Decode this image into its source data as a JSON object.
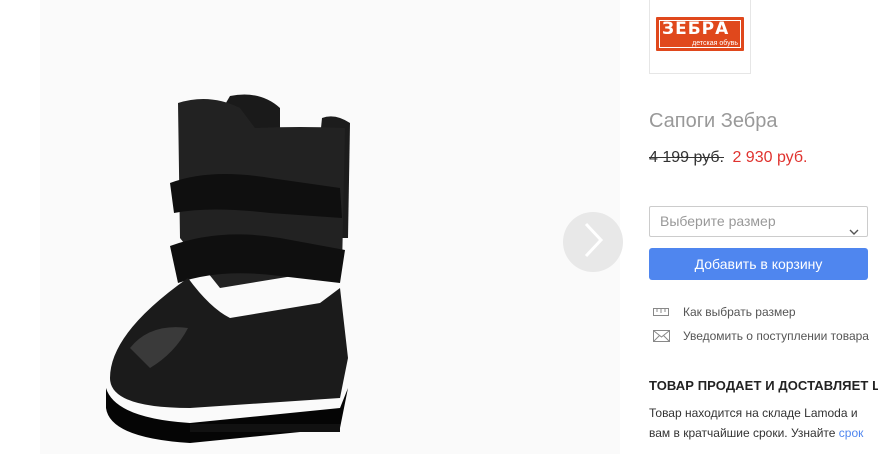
{
  "product": {
    "brand_logo": {
      "name": "ЗЕБРА",
      "tagline": "детская обувь"
    },
    "title": "Сапоги Зебра",
    "old_price": "4 199 руб.",
    "new_price": "2 930 руб."
  },
  "size_select": {
    "placeholder": "Выберите размер"
  },
  "cart_button": {
    "label": "Добавить в корзину"
  },
  "links": {
    "size_guide": "Как выбрать размер",
    "notify": "Уведомить о поступлении товара"
  },
  "seller": {
    "heading": "ТОВАР ПРОДАЕТ И ДОСТАВЛЯЕТ LA",
    "line1": "Товар находится на складе Lamoda и",
    "line2": "вам в кратчайшие сроки. Узнайте ",
    "line2_link": "срок"
  },
  "icons": {
    "next": "chevron-right-icon",
    "dropdown": "chevron-down-icon",
    "ruler": "ruler-icon",
    "envelope": "envelope-icon"
  },
  "colors": {
    "accent": "#4f86ef",
    "sale_price": "#e0332f",
    "brand": "#e0481c"
  }
}
